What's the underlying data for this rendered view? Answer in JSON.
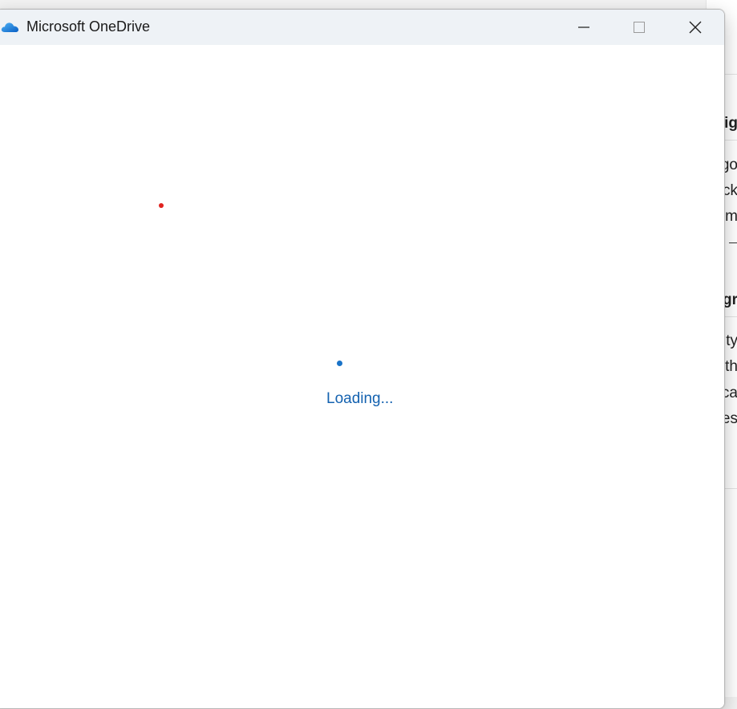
{
  "window": {
    "title": "Microsoft OneDrive",
    "icon": "onedrive-cloud-icon",
    "controls": {
      "minimize_icon": "minimize-icon",
      "maximize_icon": "maximize-icon",
      "close_icon": "close-icon"
    }
  },
  "content": {
    "loading_text": "Loading..."
  },
  "background_app": {
    "fragments": [
      "ig",
      "go",
      "ck",
      "m",
      "gr",
      "lity",
      "th",
      "ca",
      "es"
    ]
  },
  "colors": {
    "accent": "#1462b0",
    "spinner": "#1a73c8",
    "indicator": "#e0231f",
    "titlebar": "#eef2f6"
  }
}
